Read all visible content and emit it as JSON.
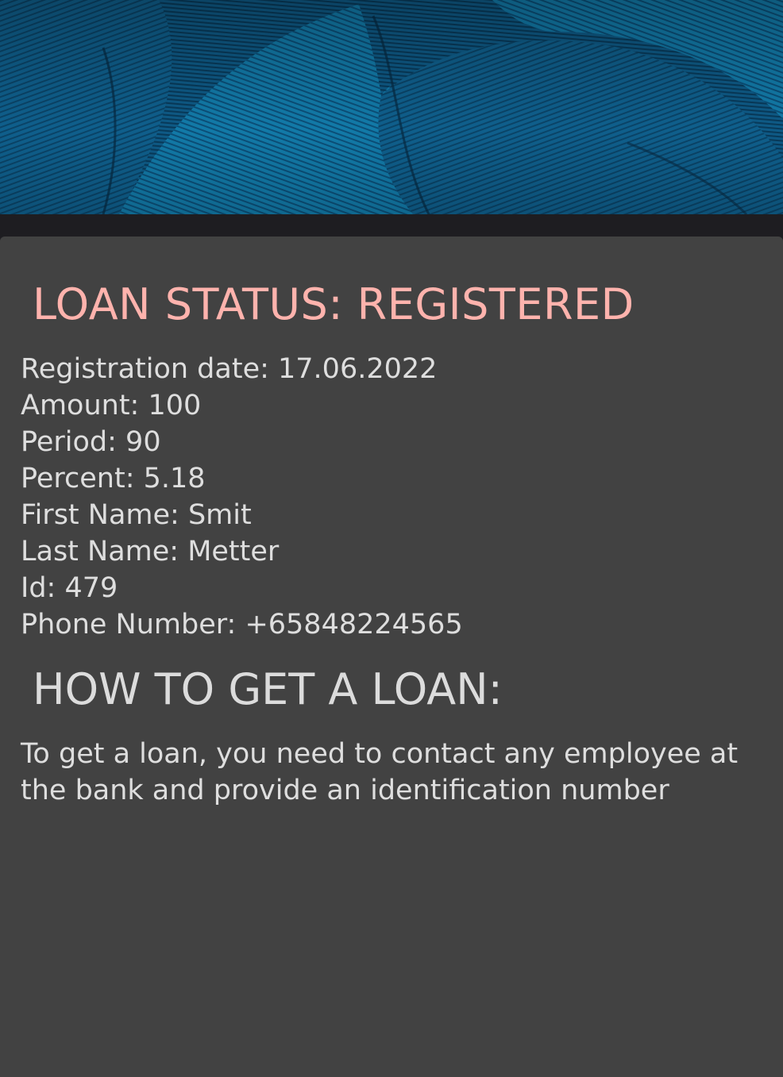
{
  "header": {
    "image_name": "blue-feathers-photo",
    "image_colors": [
      "#0a3c5e",
      "#1270a0",
      "#0c5a86"
    ]
  },
  "loan_status": {
    "title": "LOAN STATUS: REGISTERED",
    "title_color": "#ffb3ad"
  },
  "details": [
    "Registration date: 17.06.2022",
    "Amount: 100",
    "Period: 90",
    "Percent: 5.18",
    "First Name: Smit",
    "Last Name: Metter",
    "Id: 479",
    "Phone Number: +65848224565"
  ],
  "how_to": {
    "title": "HOW TO GET A LOAN:",
    "text": "To get a loan, you need to contact any employee at the bank and provide an identification number"
  }
}
